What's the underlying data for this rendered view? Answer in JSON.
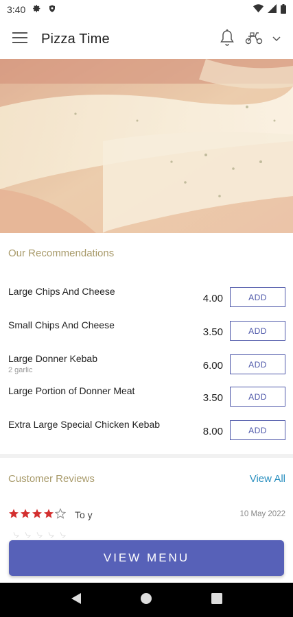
{
  "status": {
    "time": "3:40"
  },
  "header": {
    "title": "Pizza Time"
  },
  "recommendations": {
    "title": "Our Recommendations",
    "add_label": "ADD",
    "items": [
      {
        "name": "Large Chips And Cheese",
        "sub": "",
        "price": "4.00"
      },
      {
        "name": "Small Chips And Cheese",
        "sub": "",
        "price": "3.50"
      },
      {
        "name": "Large Donner Kebab",
        "sub": "2 garlic",
        "price": "6.00"
      },
      {
        "name": "Large Portion of Donner Meat",
        "sub": "",
        "price": "3.50"
      },
      {
        "name": "Extra Large Special Chicken Kebab",
        "sub": "",
        "price": "8.00"
      }
    ]
  },
  "reviews": {
    "title": "Customer Reviews",
    "view_all": "View All",
    "items": [
      {
        "rating": 4,
        "max": 5,
        "text": "To y",
        "date": "10 May 2022"
      }
    ]
  },
  "cta": {
    "label": "VIEW MENU"
  },
  "colors": {
    "accent": "#5761b8",
    "star": "#d32f2f",
    "section_title": "#a89a6a",
    "link": "#2a8fbf"
  },
  "icons": [
    "settings-icon",
    "shield-icon",
    "wifi-icon",
    "signal-icon",
    "battery-icon",
    "menu-icon",
    "bell-icon",
    "scooter-icon",
    "chevron-down-icon",
    "back-icon",
    "home-icon",
    "recents-icon",
    "star-icon"
  ]
}
